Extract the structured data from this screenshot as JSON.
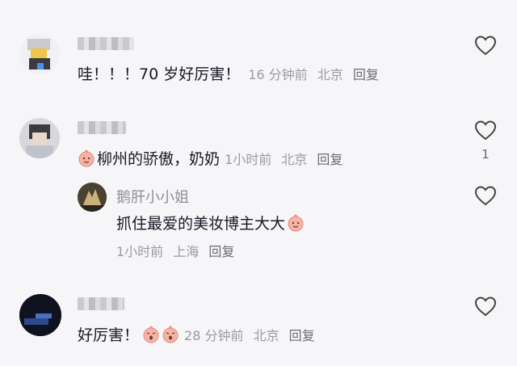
{
  "comments": [
    {
      "text": "哇！！！70 岁好厉害！",
      "time": "16 分钟前",
      "location": "北京",
      "reply_label": "回复"
    },
    {
      "text": "柳州的骄傲，奶奶",
      "emoji_before": "smile-blush-emoji",
      "time": "1小时前",
      "location": "北京",
      "reply_label": "回复",
      "like_count": "1",
      "reply": {
        "username": "鹅肝小小姐",
        "text": "抓住最爱的美妆博主大大",
        "emoji_after": "smile-blush-emoji",
        "time": "1小时前",
        "location": "上海",
        "reply_label": "回复"
      }
    },
    {
      "text": "好厉害！",
      "emojis_after": [
        "surprised-emoji",
        "surprised-emoji"
      ],
      "time": "28 分钟前",
      "location": "北京",
      "reply_label": "回复"
    }
  ],
  "colors": {
    "background": "#f6f6f8",
    "text": "#161823",
    "meta": "#9a9aa2",
    "emoji": "#f7b4a6"
  }
}
